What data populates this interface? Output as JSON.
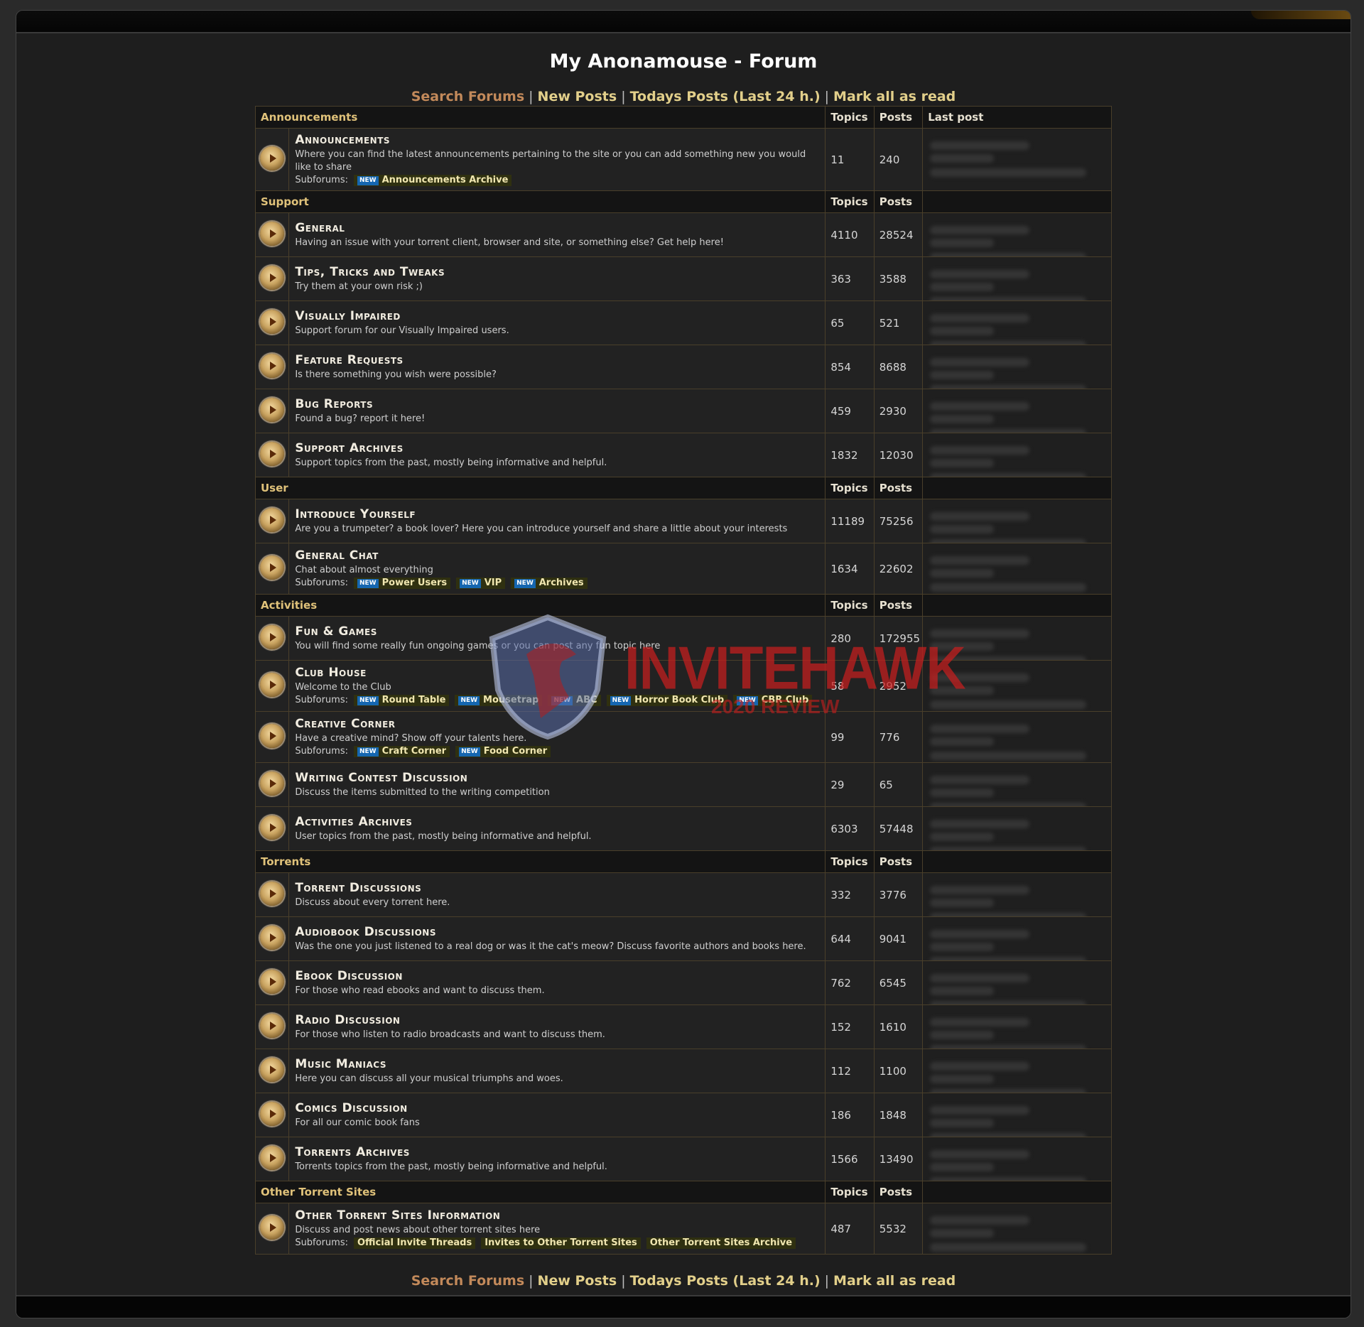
{
  "page": {
    "title": "My Anonamouse - Forum"
  },
  "nav": {
    "search": "Search Forums",
    "new_posts": "New Posts",
    "todays_posts": "Todays Posts (Last 24 h.)",
    "mark_read": "Mark all as read",
    "separator": "|"
  },
  "columns": {
    "topics": "Topics",
    "posts": "Posts",
    "last_post": "Last post"
  },
  "subforums_label": "Subforums:",
  "new_badge": "NEW",
  "watermark": {
    "brand": "INVITEHAWK",
    "sub": "2020 REVIEW"
  },
  "categories": [
    {
      "name": "Announcements",
      "forums": [
        {
          "name": "Announcements",
          "desc": "Where you can find the latest announcements pertaining to the site or you can add something new you would like to share",
          "topics": "11",
          "posts": "240",
          "subforums": [
            {
              "name": "Announcements Archive",
              "new": true
            }
          ]
        }
      ]
    },
    {
      "name": "Support",
      "forums": [
        {
          "name": "General",
          "desc": "Having an issue with your torrent client, browser and site, or something else? Get help here!",
          "topics": "4110",
          "posts": "28524"
        },
        {
          "name": "Tips, Tricks and Tweaks",
          "desc": "Try them at your own risk ;)",
          "topics": "363",
          "posts": "3588"
        },
        {
          "name": "Visually Impaired",
          "desc": "Support forum for our Visually Impaired users.",
          "topics": "65",
          "posts": "521"
        },
        {
          "name": "Feature Requests",
          "desc": "Is there something you wish were possible?",
          "topics": "854",
          "posts": "8688"
        },
        {
          "name": "Bug Reports",
          "desc": "Found a bug? report it here!",
          "topics": "459",
          "posts": "2930"
        },
        {
          "name": "Support Archives",
          "desc": "Support topics from the past, mostly being informative and helpful.",
          "topics": "1832",
          "posts": "12030"
        }
      ]
    },
    {
      "name": "User",
      "forums": [
        {
          "name": "Introduce Yourself",
          "desc": "Are you a trumpeter? a book lover? Here you can introduce yourself and share a little about your interests",
          "topics": "11189",
          "posts": "75256"
        },
        {
          "name": "General Chat",
          "desc": "Chat about almost everything",
          "topics": "1634",
          "posts": "22602",
          "subforums": [
            {
              "name": "Power Users",
              "new": true
            },
            {
              "name": "VIP",
              "new": true
            },
            {
              "name": "Archives",
              "new": true
            }
          ]
        }
      ]
    },
    {
      "name": "Activities",
      "forums": [
        {
          "name": "Fun & Games",
          "desc": "You will find some really fun ongoing games or you can post any fun topic here",
          "topics": "280",
          "posts": "172955"
        },
        {
          "name": "Club House",
          "desc": "Welcome to the Club",
          "topics": "58",
          "posts": "2952",
          "subforums": [
            {
              "name": "Round Table",
              "new": true
            },
            {
              "name": "Mousetrap",
              "new": true
            },
            {
              "name": "ABC",
              "new": true
            },
            {
              "name": "Horror Book Club",
              "new": true
            },
            {
              "name": "CBR Club",
              "new": true
            }
          ]
        },
        {
          "name": "Creative Corner",
          "desc": "Have a creative mind? Show off your talents here.",
          "topics": "99",
          "posts": "776",
          "subforums": [
            {
              "name": "Craft Corner",
              "new": true
            },
            {
              "name": "Food Corner",
              "new": true
            }
          ]
        },
        {
          "name": "Writing Contest Discussion",
          "desc": "Discuss the items submitted to the writing competition",
          "topics": "29",
          "posts": "65"
        },
        {
          "name": "Activities Archives",
          "desc": "User topics from the past, mostly being informative and helpful.",
          "topics": "6303",
          "posts": "57448"
        }
      ]
    },
    {
      "name": "Torrents",
      "forums": [
        {
          "name": "Torrent Discussions",
          "desc": "Discuss about every torrent here.",
          "topics": "332",
          "posts": "3776"
        },
        {
          "name": "Audiobook Discussions",
          "desc": "Was the one you just listened to a real dog or was it the cat's meow? Discuss favorite authors and books here.",
          "topics": "644",
          "posts": "9041"
        },
        {
          "name": "Ebook Discussion",
          "desc": "For those who read ebooks and want to discuss them.",
          "topics": "762",
          "posts": "6545"
        },
        {
          "name": "Radio Discussion",
          "desc": "For those who listen to radio broadcasts and want to discuss them.",
          "topics": "152",
          "posts": "1610"
        },
        {
          "name": "Music Maniacs",
          "desc": "Here you can discuss all your musical triumphs and woes.",
          "topics": "112",
          "posts": "1100"
        },
        {
          "name": "Comics Discussion",
          "desc": "For all our comic book fans",
          "topics": "186",
          "posts": "1848"
        },
        {
          "name": "Torrents Archives",
          "desc": "Torrents topics from the past, mostly being informative and helpful.",
          "topics": "1566",
          "posts": "13490"
        }
      ]
    },
    {
      "name": "Other Torrent Sites",
      "forums": [
        {
          "name": "Other Torrent Sites Information",
          "desc": "Discuss and post news about other torrent sites here",
          "topics": "487",
          "posts": "5532",
          "subforums": [
            {
              "name": "Official Invite Threads",
              "new": false
            },
            {
              "name": "Invites to Other Torrent Sites",
              "new": false
            },
            {
              "name": "Other Torrent Sites Archive",
              "new": false
            }
          ]
        }
      ]
    }
  ]
}
